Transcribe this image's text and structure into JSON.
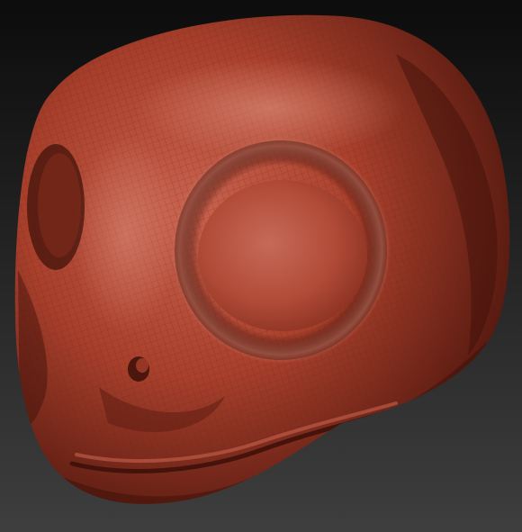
{
  "scene": {
    "subject": "sculpted-creature-head",
    "material": "red-clay-wireframe",
    "colors": {
      "background_top": "#0c0c0c",
      "background_bottom": "#3e3e3e",
      "clay_light": "#c8634f",
      "clay_mid": "#a9402c",
      "clay_dark": "#5e1d12",
      "clay_deep": "#3b0f08",
      "wire": "#6a2418"
    }
  }
}
